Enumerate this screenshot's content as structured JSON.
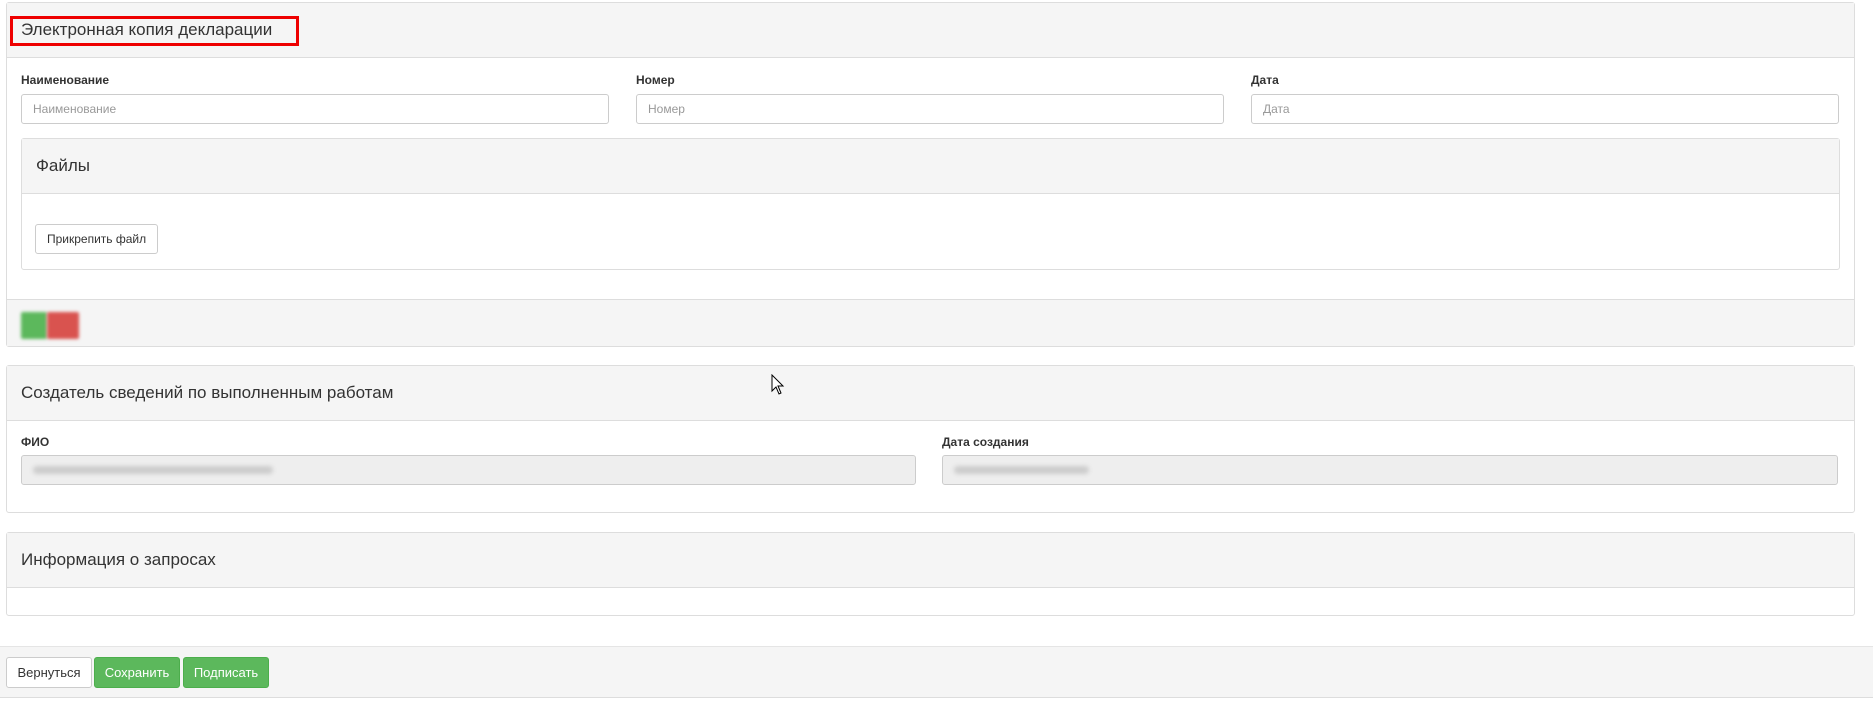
{
  "declaration": {
    "title": "Электронная копия декларации",
    "fields": {
      "name": {
        "label": "Наименование",
        "placeholder": "Наименование",
        "value": ""
      },
      "number": {
        "label": "Номер",
        "placeholder": "Номер",
        "value": ""
      },
      "date": {
        "label": "Дата",
        "placeholder": "Дата",
        "value": ""
      }
    },
    "files": {
      "title": "Файлы",
      "attach_label": "Прикрепить файл"
    },
    "colors": {
      "add_button": "#5cb85c",
      "remove_button": "#d9534f"
    }
  },
  "creator": {
    "title": "Создатель сведений по выполненным работам",
    "fio_label": "ФИО",
    "created_label": "Дата создания"
  },
  "requests": {
    "title": "Информация о запросах"
  },
  "footer": {
    "back_label": "Вернуться",
    "save_label": "Сохранить",
    "sign_label": "Подписать"
  },
  "colors": {
    "success": "#5cb85c",
    "highlight": "#e00000"
  }
}
